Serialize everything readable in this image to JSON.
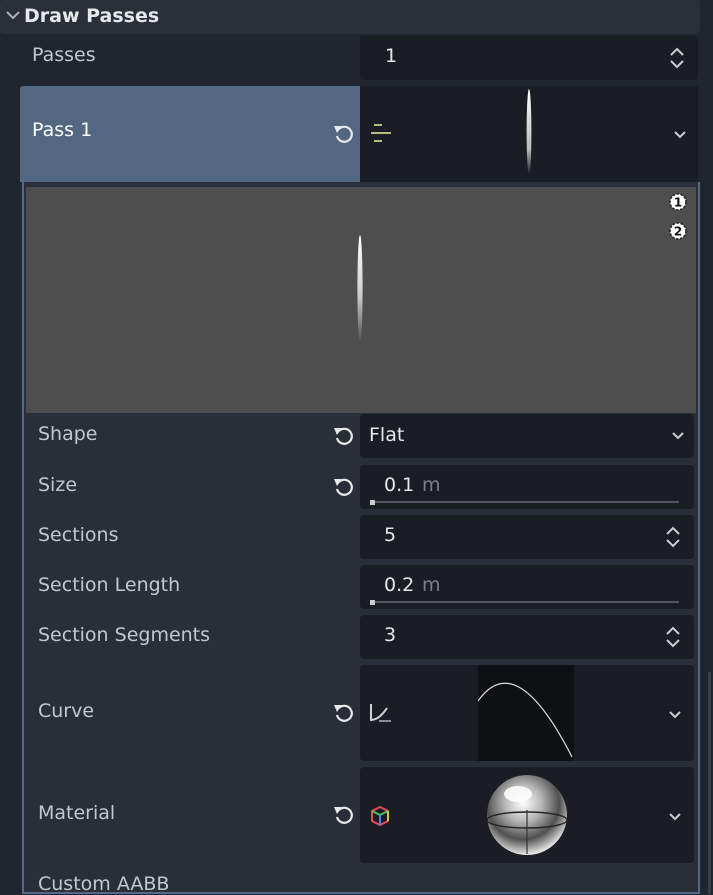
{
  "section": {
    "title": "Draw Passes"
  },
  "passes": {
    "label": "Passes",
    "value": "1"
  },
  "pass1": {
    "label": "Pass 1"
  },
  "preview": {
    "marker_1": "1",
    "marker_2": "2"
  },
  "properties": {
    "shape": {
      "label": "Shape",
      "value": "Flat"
    },
    "size": {
      "label": "Size",
      "value": "0.1",
      "unit": "m",
      "slider": 0.0
    },
    "sections": {
      "label": "Sections",
      "value": "5"
    },
    "section_length": {
      "label": "Section Length",
      "value": "0.2",
      "unit": "m",
      "slider": 0.0
    },
    "section_segments": {
      "label": "Section Segments",
      "value": "3"
    },
    "curve": {
      "label": "Curve"
    },
    "material": {
      "label": "Material"
    },
    "custom_aabb": {
      "label": "Custom AABB"
    }
  },
  "icons": {
    "collapse": "chevron-down-icon",
    "revert": "revert-icon",
    "stepper": "updown-arrows-icon",
    "dropdown": "chevron-down-icon",
    "mesh": "ribbon-mesh-icon",
    "curve": "curve-icon",
    "material": "material-icon"
  },
  "colors": {
    "accent": "#536782",
    "panel": "#21252f",
    "field": "#1b1d24"
  }
}
